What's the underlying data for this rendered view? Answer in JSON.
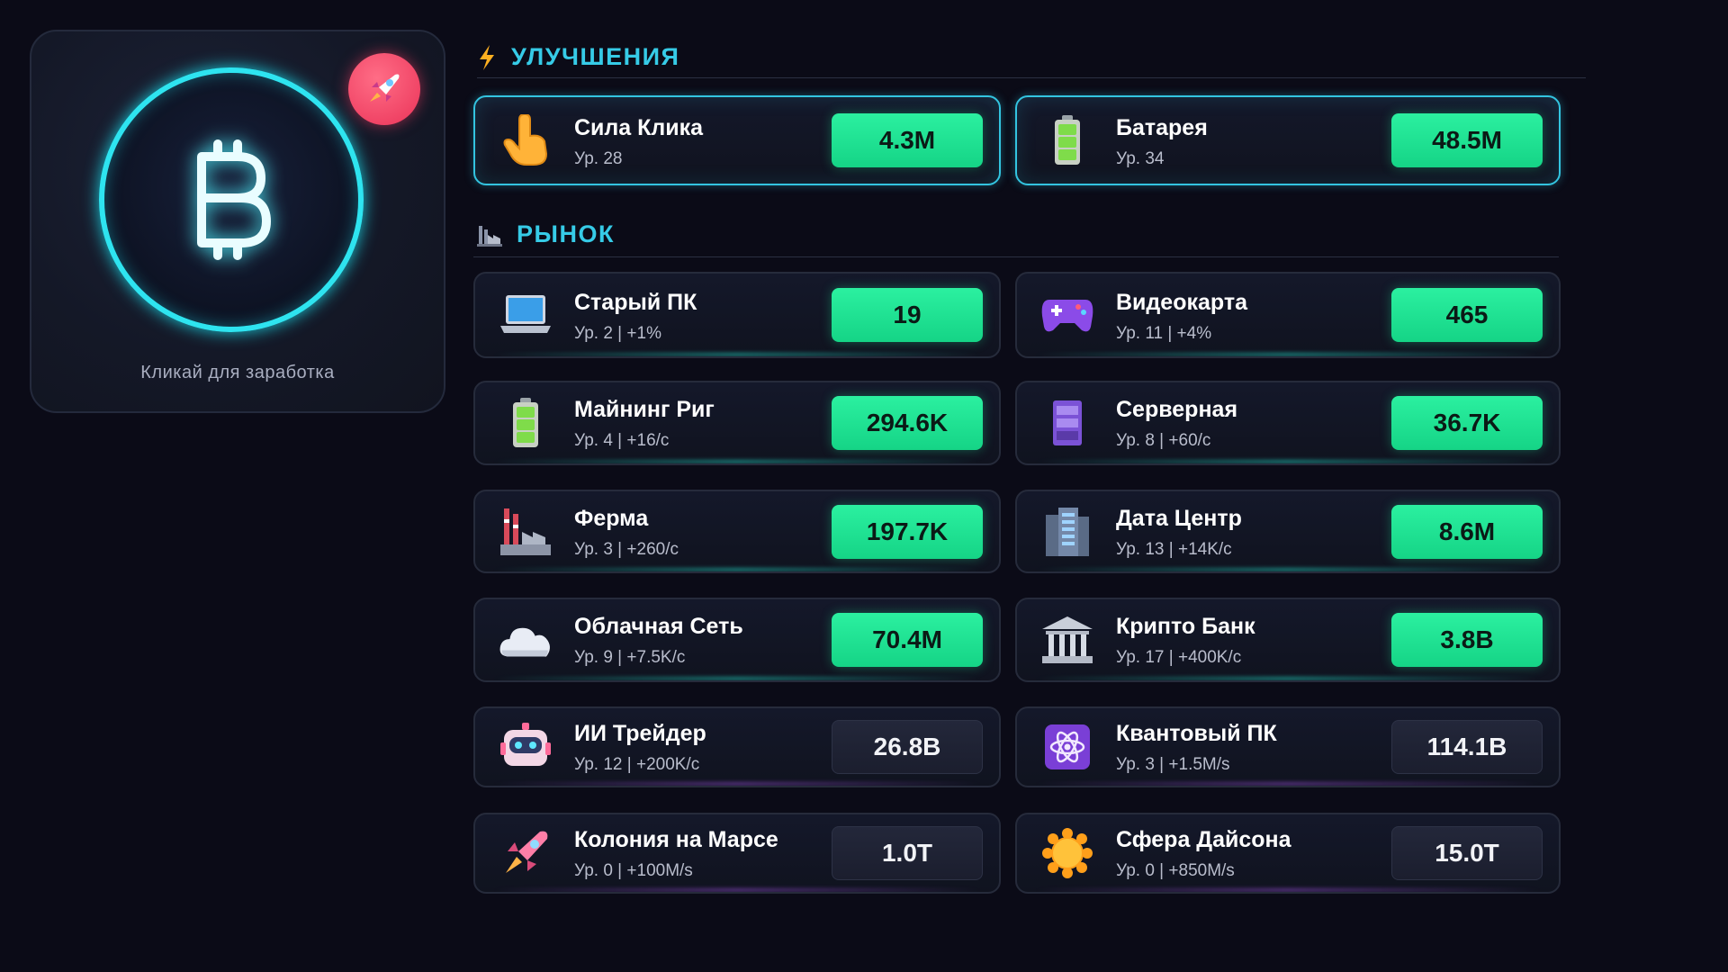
{
  "clicker": {
    "coin_icon": "bitcoin-icon",
    "boost_icon": "rocket-icon",
    "label": "Кликай для заработка"
  },
  "upgrades": {
    "title": "УЛУЧШЕНИЯ",
    "icon": "lightning-icon",
    "items": [
      {
        "name": "Сила Клика",
        "level": "Ур. 28",
        "price": "4.3M",
        "icon": "pointing-hand-icon"
      },
      {
        "name": "Батарея",
        "level": "Ур. 34",
        "price": "48.5M",
        "icon": "battery-icon"
      }
    ]
  },
  "market": {
    "title": "РЫНОК",
    "icon": "factory-icon",
    "items": [
      {
        "name": "Старый ПК",
        "sub": "Ур. 2 | +1%",
        "price": "19",
        "icon": "laptop-icon",
        "affordable": true
      },
      {
        "name": "Видеокарта",
        "sub": "Ур. 11 | +4%",
        "price": "465",
        "icon": "gamepad-icon",
        "affordable": true
      },
      {
        "name": "Майнинг Риг",
        "sub": "Ур. 4 | +16/с",
        "price": "294.6K",
        "icon": "battery-icon",
        "affordable": true
      },
      {
        "name": "Серверная",
        "sub": "Ур. 8 | +60/с",
        "price": "36.7K",
        "icon": "server-icon",
        "affordable": true
      },
      {
        "name": "Ферма",
        "sub": "Ур. 3 | +260/с",
        "price": "197.7K",
        "icon": "factory-icon",
        "affordable": true
      },
      {
        "name": "Дата Центр",
        "sub": "Ур. 13 | +14K/с",
        "price": "8.6M",
        "icon": "building-icon",
        "affordable": true
      },
      {
        "name": "Облачная Сеть",
        "sub": "Ур. 9 | +7.5K/с",
        "price": "70.4M",
        "icon": "cloud-icon",
        "affordable": true
      },
      {
        "name": "Крипто Банк",
        "sub": "Ур. 17 | +400K/с",
        "price": "3.8B",
        "icon": "bank-icon",
        "affordable": true
      },
      {
        "name": "ИИ Трейдер",
        "sub": "Ур. 12 | +200K/с",
        "price": "26.8B",
        "icon": "robot-icon",
        "affordable": false
      },
      {
        "name": "Квантовый ПК",
        "sub": "Ур. 3 | +1.5M/s",
        "price": "114.1B",
        "icon": "atom-icon",
        "affordable": false
      },
      {
        "name": "Колония на Марсе",
        "sub": "Ур. 0 | +100M/s",
        "price": "1.0T",
        "icon": "rocket-icon",
        "affordable": false
      },
      {
        "name": "Сфера Дайсона",
        "sub": "Ур. 0 | +850M/s",
        "price": "15.0T",
        "icon": "sun-icon",
        "affordable": false
      }
    ]
  },
  "colors": {
    "accent": "#36cbe7",
    "buy_green": "#15d486",
    "boost": "#ea3358",
    "background": "#0b0b17"
  }
}
